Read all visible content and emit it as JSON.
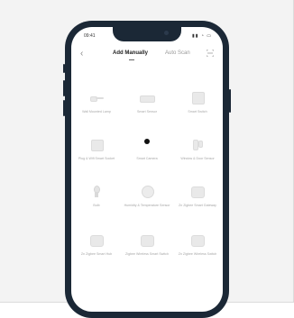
{
  "status_bar": {
    "time": "09:41",
    "icons": "▮▮ ◔ ▭"
  },
  "header": {
    "back_icon": "chevron-left-icon",
    "tabs": [
      {
        "label": "Add Manually",
        "active": true
      },
      {
        "label": "Auto Scan",
        "active": false
      }
    ],
    "scan_icon": "scan-icon"
  },
  "devices": [
    {
      "label": "Wall Mounted Lamp",
      "icon": "wall-lamp-icon"
    },
    {
      "label": "Smart Sensor",
      "icon": "sensor-bar-icon"
    },
    {
      "label": "Smart Switch",
      "icon": "switch-panel-icon"
    },
    {
      "label": "Plug & Wifi Smart Socket",
      "icon": "smart-plug-icon"
    },
    {
      "label": "Smart Camera",
      "icon": "camera-icon"
    },
    {
      "label": "Window & Door Sensor",
      "icon": "door-sensor-icon"
    },
    {
      "label": "Bulb",
      "icon": "bulb-icon"
    },
    {
      "label": "Humidity & Temperature Sensor",
      "icon": "thermo-sensor-icon"
    },
    {
      "label": "Zn Zigbee Smart Gateway",
      "icon": "gateway-icon"
    },
    {
      "label": "Zn Zigbee Smart Hub",
      "icon": "hub-icon"
    },
    {
      "label": "Zigbee Wireless Smart Switch",
      "icon": "wireless-switch-icon"
    },
    {
      "label": "Zn Zigbee Wireless Switch",
      "icon": "wireless-switch-icon"
    }
  ]
}
